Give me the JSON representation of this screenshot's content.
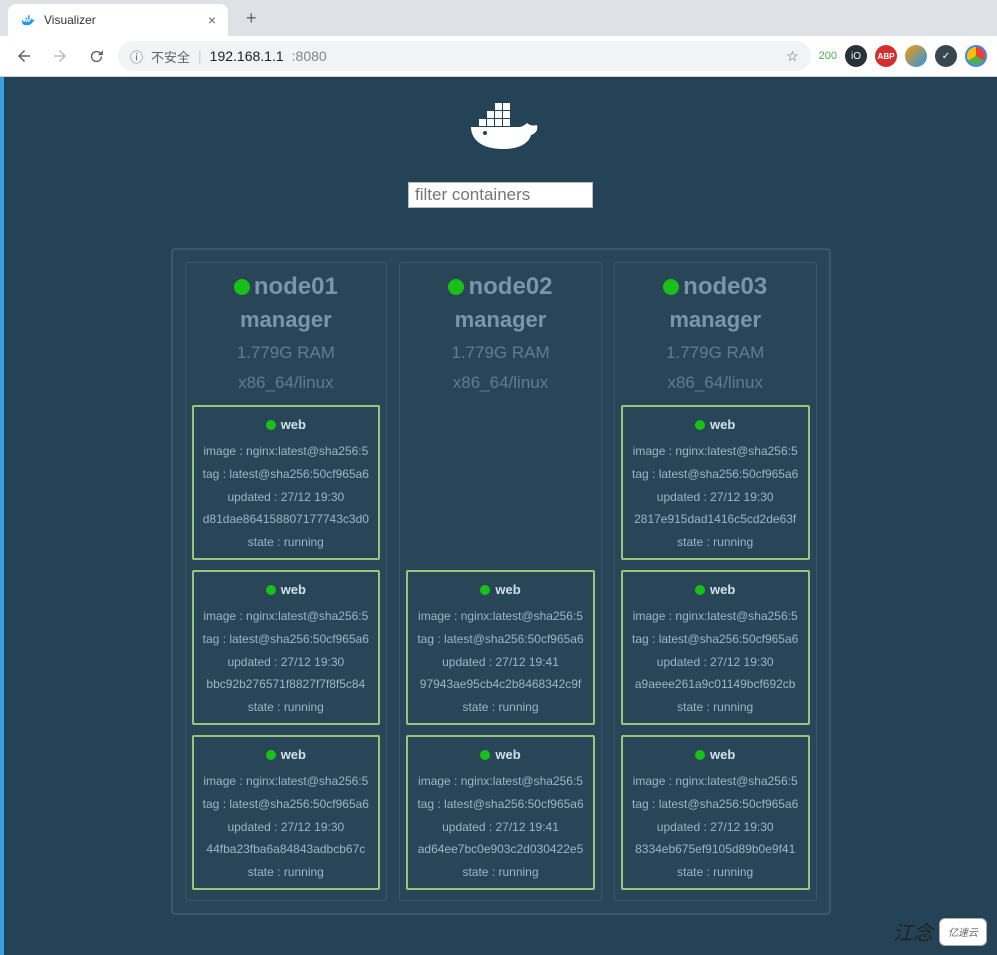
{
  "browser": {
    "tab_title": "Visualizer",
    "security_label": "不安全",
    "url_host": "192.168.1.1",
    "url_port": ":8080",
    "http_status": "200"
  },
  "filter": {
    "placeholder": "filter containers"
  },
  "nodes": [
    {
      "name": "node01",
      "role": "manager",
      "ram": "1.779G RAM",
      "arch": "x86_64/linux",
      "containers": [
        {
          "name": "web",
          "image": "image : nginx:latest@sha256:5",
          "tag": "tag : latest@sha256:50cf965a6",
          "updated": "updated : 27/12 19:30",
          "id": "d81dae864158807177743c3d0",
          "state": "state : running"
        },
        {
          "name": "web",
          "image": "image : nginx:latest@sha256:5",
          "tag": "tag : latest@sha256:50cf965a6",
          "updated": "updated : 27/12 19:30",
          "id": "bbc92b276571f8827f7f8f5c84",
          "state": "state : running"
        },
        {
          "name": "web",
          "image": "image : nginx:latest@sha256:5",
          "tag": "tag : latest@sha256:50cf965a6",
          "updated": "updated : 27/12 19:30",
          "id": "44fba23fba6a84843adbcb67c",
          "state": "state : running"
        }
      ]
    },
    {
      "name": "node02",
      "role": "manager",
      "ram": "1.779G RAM",
      "arch": "x86_64/linux",
      "containers": [
        null,
        {
          "name": "web",
          "image": "image : nginx:latest@sha256:5",
          "tag": "tag : latest@sha256:50cf965a6",
          "updated": "updated : 27/12 19:41",
          "id": "97943ae95cb4c2b8468342c9f",
          "state": "state : running"
        },
        {
          "name": "web",
          "image": "image : nginx:latest@sha256:5",
          "tag": "tag : latest@sha256:50cf965a6",
          "updated": "updated : 27/12 19:41",
          "id": "ad64ee7bc0e903c2d030422e5",
          "state": "state : running"
        }
      ]
    },
    {
      "name": "node03",
      "role": "manager",
      "ram": "1.779G RAM",
      "arch": "x86_64/linux",
      "containers": [
        {
          "name": "web",
          "image": "image : nginx:latest@sha256:5",
          "tag": "tag : latest@sha256:50cf965a6",
          "updated": "updated : 27/12 19:30",
          "id": "2817e915dad1416c5cd2de63f",
          "state": "state : running"
        },
        {
          "name": "web",
          "image": "image : nginx:latest@sha256:5",
          "tag": "tag : latest@sha256:50cf965a6",
          "updated": "updated : 27/12 19:30",
          "id": "a9aeee261a9c01149bcf692cb",
          "state": "state : running"
        },
        {
          "name": "web",
          "image": "image : nginx:latest@sha256:5",
          "tag": "tag : latest@sha256:50cf965a6",
          "updated": "updated : 27/12 19:30",
          "id": "8334eb675ef9105d89b0e9f41",
          "state": "state : running"
        }
      ]
    }
  ],
  "watermark": {
    "text": "江念",
    "logo": "亿速云"
  }
}
